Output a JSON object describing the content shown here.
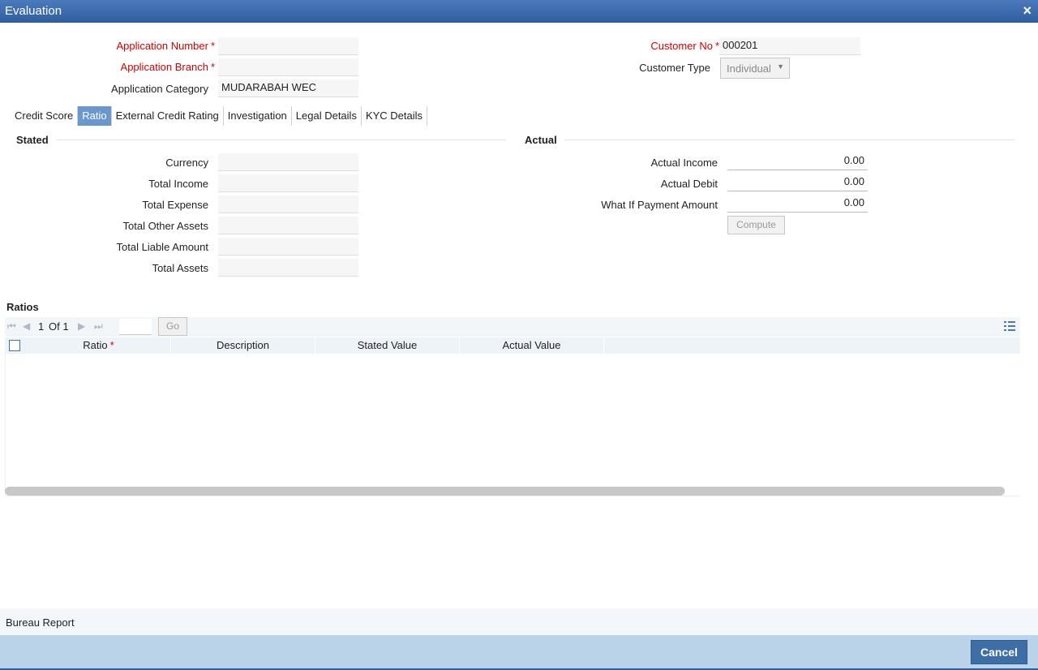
{
  "window": {
    "title": "Evaluation",
    "close_icon": "×"
  },
  "header": {
    "application_number_label": "Application Number",
    "application_number_value": "",
    "application_branch_label": "Application Branch",
    "application_branch_value": "",
    "application_category_label": "Application Category",
    "application_category_value": "MUDARABAH WEC",
    "customer_no_label": "Customer No",
    "customer_no_value": "000201",
    "customer_type_label": "Customer Type",
    "customer_type_value": "Individual",
    "required_marker": "*"
  },
  "tabs": [
    {
      "label": "Credit Score"
    },
    {
      "label": "Ratio",
      "active": true
    },
    {
      "label": "External Credit Rating"
    },
    {
      "label": "Investigation"
    },
    {
      "label": "Legal Details"
    },
    {
      "label": "KYC Details"
    }
  ],
  "stated": {
    "heading": "Stated",
    "currency_label": "Currency",
    "currency_value": "",
    "total_income_label": "Total Income",
    "total_income_value": "",
    "total_expense_label": "Total Expense",
    "total_expense_value": "",
    "total_other_assets_label": "Total Other Assets",
    "total_other_assets_value": "",
    "total_liable_amount_label": "Total Liable Amount",
    "total_liable_amount_value": "",
    "total_assets_label": "Total Assets",
    "total_assets_value": ""
  },
  "actual": {
    "heading": "Actual",
    "actual_income_label": "Actual Income",
    "actual_income_value": "0.00",
    "actual_debit_label": "Actual Debit",
    "actual_debit_value": "0.00",
    "what_if_label": "What If Payment Amount",
    "what_if_value": "0.00",
    "compute_label": "Compute"
  },
  "ratios": {
    "heading": "Ratios",
    "page_current": "1",
    "page_of": "Of 1",
    "go_label": "Go",
    "columns": [
      "Ratio",
      "Description",
      "Stated Value",
      "Actual Value"
    ],
    "rows": []
  },
  "bureau_report_label": "Bureau Report",
  "footer": {
    "cancel_label": "Cancel"
  },
  "colors": {
    "title_bar": "#2e5f9f",
    "required": "#d40000",
    "active_tab": "#6a97d0",
    "footer": "#bad3e9"
  }
}
